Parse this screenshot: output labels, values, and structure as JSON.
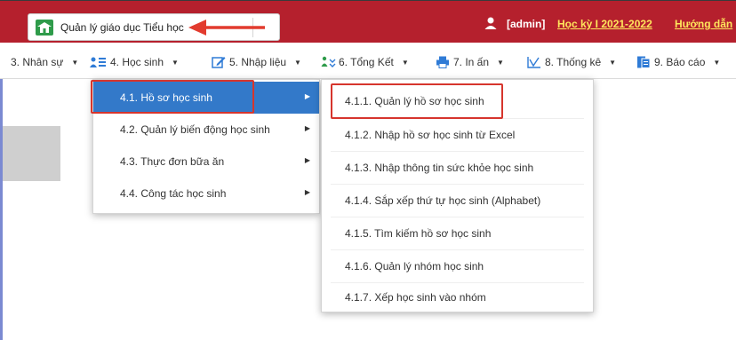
{
  "header": {
    "module_label": "Quản lý giáo dục Tiểu học",
    "user_label": "[admin]",
    "term_link": "Học kỳ I 2021-2022",
    "help_link": "Hướng dẫn"
  },
  "menu": [
    {
      "label": "3. Nhân sự"
    },
    {
      "label": "4. Học sinh"
    },
    {
      "label": "5. Nhập liệu"
    },
    {
      "label": "6. Tổng Kết"
    },
    {
      "label": "7. In ấn"
    },
    {
      "label": "8. Thống kê"
    },
    {
      "label": "9. Báo cáo"
    }
  ],
  "submenu_hoc_sinh": [
    {
      "label": "4.1. Hồ sơ học sinh",
      "active": true
    },
    {
      "label": "4.2. Quản lý biến động học sinh"
    },
    {
      "label": "4.3. Thực đơn bữa ăn"
    },
    {
      "label": "4.4. Công tác học sinh"
    }
  ],
  "submenu_ho_so": [
    {
      "label": "4.1.1. Quản lý hồ sơ học sinh",
      "highlighted": true
    },
    {
      "label": "4.1.2. Nhập hồ sơ học sinh từ Excel"
    },
    {
      "label": "4.1.3. Nhập thông tin sức khỏe học sinh"
    },
    {
      "label": "4.1.4. Sắp xếp thứ tự học sinh (Alphabet)"
    },
    {
      "label": "4.1.5. Tìm kiếm hồ sơ học sinh"
    },
    {
      "label": "4.1.6. Quản lý nhóm học sinh"
    },
    {
      "label": "4.1.7. Xếp học sinh vào nhóm"
    }
  ],
  "colors": {
    "header_bg": "#b5202d",
    "link_yellow": "#ffe65c",
    "active_item_bg": "#3379c9",
    "highlight_red": "#d6352d"
  }
}
